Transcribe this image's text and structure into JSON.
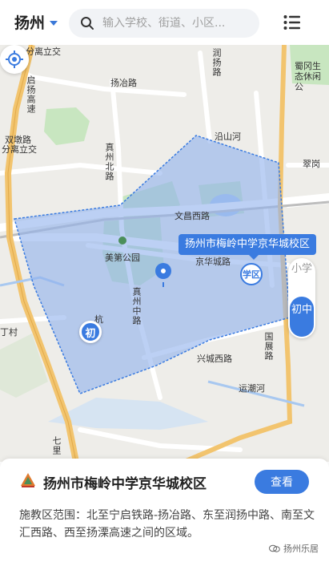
{
  "header": {
    "city": "扬州",
    "search_placeholder": "输入学校、街道、小区..."
  },
  "map": {
    "labels": {
      "fenqiao": "分离立交",
      "yangye_road": "扬冶路",
      "qiyang_gaosu": "启扬高速",
      "runyang": "润扬路",
      "shugang": "蜀冈生态休闲公",
      "yanshan_river": "沿山河",
      "shuangdun": "双墩路",
      "fenqiao2": "分离立交",
      "zhenzhou_north": "真州北路",
      "cuiyuan": "翠岗",
      "wenchang_west": "文昌西路",
      "meidi_park": "美第公园",
      "jinghua_cheng": "京华城路",
      "zhenzhou_mid": "真州中路",
      "xingcheng_west": "兴城西路",
      "guozhan": "国展路",
      "yunchao_river": "运潮河",
      "dingcun": "丁村",
      "qili": "七里",
      "hang": "杭"
    },
    "school_callout": "扬州市梅岭中学京华城校区",
    "xuequ_marker": "学区",
    "chu_marker": "初",
    "level_toggle": {
      "xiaoxue": "小学",
      "chuzhong": "初中"
    }
  },
  "card": {
    "title": "扬州市梅岭中学京华城校区",
    "view_button": "查看",
    "description": "施教区范围：北至宁启铁路-扬冶路、东至润扬中路、南至文汇西路、西至扬溧高速之间的区域。",
    "watermark": "扬州乐居"
  },
  "colors": {
    "accent": "#3a7be0",
    "district_fill": "#8fb0ec",
    "map_bg": "#eeede9",
    "green": "#c8e6c0",
    "water": "#a8c8f0",
    "expressway": "#f2c46e"
  }
}
